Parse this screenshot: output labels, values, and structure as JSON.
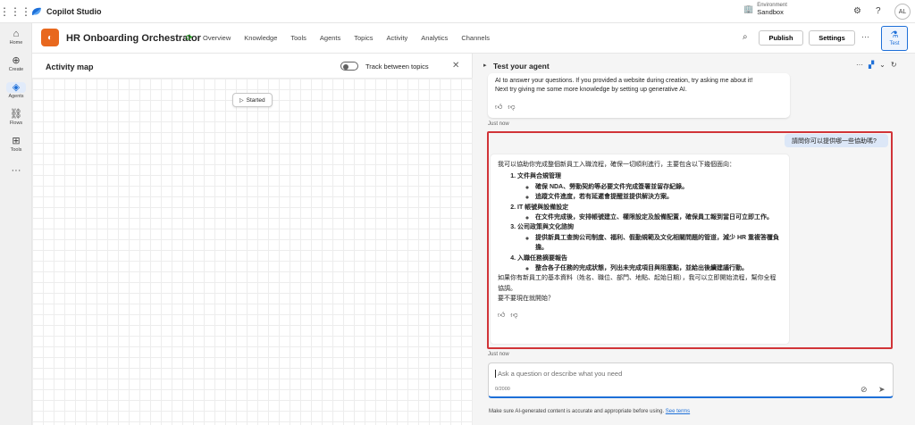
{
  "app": {
    "name": "Copilot Studio"
  },
  "environment": {
    "label": "Environment",
    "value": "Sandbox"
  },
  "user": {
    "initials": "AL"
  },
  "rail": [
    {
      "label": "Home",
      "icon": "home-icon"
    },
    {
      "label": "Create",
      "icon": "plus-circle-icon"
    },
    {
      "label": "Agents",
      "icon": "agents-icon"
    },
    {
      "label": "Flows",
      "icon": "flows-icon"
    },
    {
      "label": "Tools",
      "icon": "tools-icon"
    },
    {
      "label": "",
      "icon": "more-icon"
    }
  ],
  "header": {
    "agent_name": "HR Onboarding Orchestrator",
    "nav": [
      "Overview",
      "Knowledge",
      "Tools",
      "Agents",
      "Topics",
      "Activity",
      "Analytics",
      "Channels"
    ],
    "publish": "Publish",
    "settings": "Settings",
    "test": "Test"
  },
  "activity_map": {
    "title": "Activity map",
    "toggle_label": "Track between topics",
    "started": "Started"
  },
  "test_panel": {
    "title": "Test your agent",
    "intro_line1": "AI to answer your questions. If you provided a website during creation, try asking me about it!",
    "intro_line2": "Next try giving me some more knowledge by setting up generative AI.",
    "just_now": "Just now",
    "user_message": "請問你可以提供哪一些協助嗎?",
    "bot": {
      "intro": "我可以協助你完成整個新員工入職流程，確保一切順利進行，主要包含以下幾個面向：",
      "sections": [
        {
          "title": "文件與合規管理",
          "items": [
            "確保 NDA、勞動契約等必要文件完成簽署並留存紀錄。",
            "追蹤文件進度，若有延遲會提醒並提供解決方案。"
          ]
        },
        {
          "title": "IT 帳號與設備設定",
          "items": [
            "在文件完成後，安排帳號建立、權限設定及設備配置，確保員工報到當日可立即工作。"
          ]
        },
        {
          "title": "公司政策與文化諮詢",
          "items": [
            "提供新員工查詢公司制度、福利、假勤規範及文化相關問題的管道，減少 HR 重複答覆負擔。"
          ]
        },
        {
          "title": "入職任務摘要報告",
          "items": [
            "整合各子任務的完成狀態，列出未完成項目與阻塞點，並給出後續建議行動。"
          ]
        }
      ],
      "outro1": "如果你有新員工的基本資料（姓名、職位、部門、地點、起始日期），我可以立即開始流程，幫你全程協調。",
      "outro2": "要不要現在就開始？"
    },
    "input_placeholder": "Ask a question or describe what you need",
    "char_count": "0/2000",
    "disclaimer": "Make sure AI-generated content is accurate and appropriate before using.",
    "see_terms": "See terms"
  }
}
